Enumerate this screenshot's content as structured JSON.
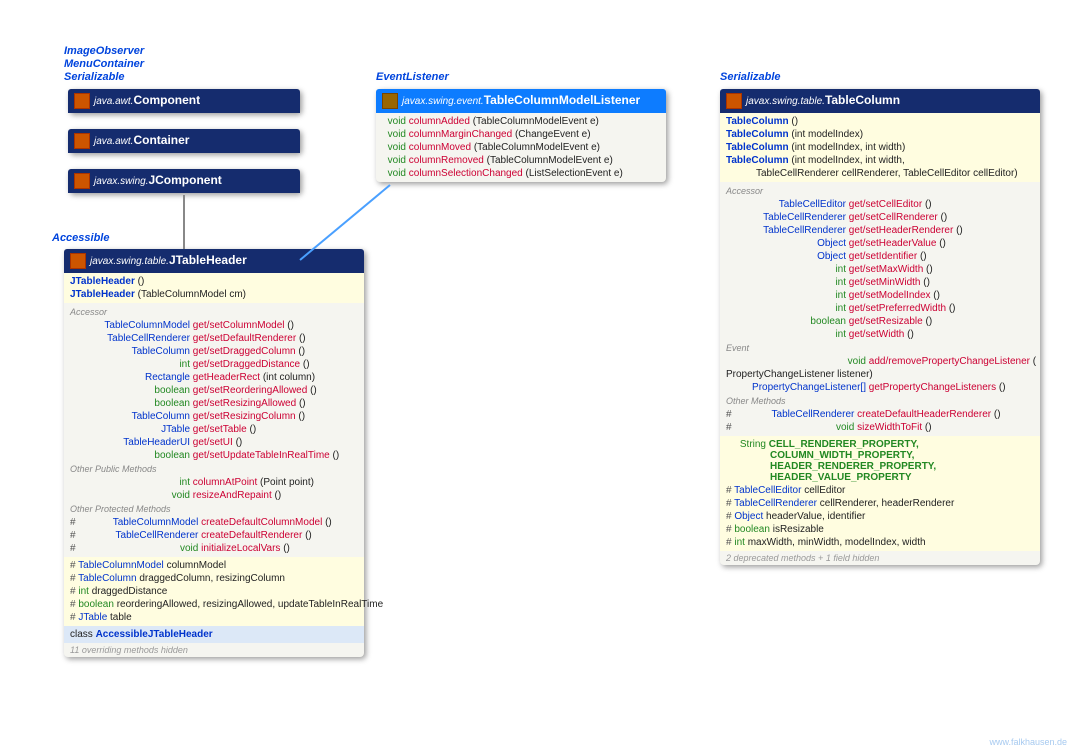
{
  "iface": {
    "imgobs": "ImageObserver",
    "menuc": "MenuContainer",
    "ser": "Serializable",
    "evl": "EventListener",
    "acc": "Accessible"
  },
  "comp": {
    "pkg": "java.awt.",
    "name": "Component"
  },
  "cont": {
    "pkg": "java.awt.",
    "name": "Container"
  },
  "jcomp": {
    "pkg": "javax.swing.",
    "name": "JComponent"
  },
  "listener": {
    "pkg": "javax.swing.event.",
    "name": "TableColumnModelListener",
    "rows": [
      {
        "ret": "void",
        "m": "columnAdded",
        "args": "(TableColumnModelEvent e)"
      },
      {
        "ret": "void",
        "m": "columnMarginChanged",
        "args": "(ChangeEvent e)"
      },
      {
        "ret": "void",
        "m": "columnMoved",
        "args": "(TableColumnModelEvent e)"
      },
      {
        "ret": "void",
        "m": "columnRemoved",
        "args": "(TableColumnModelEvent e)"
      },
      {
        "ret": "void",
        "m": "columnSelectionChanged",
        "args": "(ListSelectionEvent e)"
      }
    ]
  },
  "jth": {
    "pkg": "javax.swing.table.",
    "name": "JTableHeader",
    "ctors": [
      {
        "m": "JTableHeader",
        "args": "()"
      },
      {
        "m": "JTableHeader",
        "args": "(TableColumnModel cm)"
      }
    ],
    "accessor": [
      {
        "ret": "TableColumnModel",
        "m": "get/setColumnModel",
        "args": "()"
      },
      {
        "ret": "TableCellRenderer",
        "m": "get/setDefaultRenderer",
        "args": "()"
      },
      {
        "ret": "TableColumn",
        "m": "get/setDraggedColumn",
        "args": "()"
      },
      {
        "ret": "int",
        "m": "get/setDraggedDistance",
        "args": "()"
      },
      {
        "ret": "Rectangle",
        "m": "getHeaderRect",
        "args": "(int column)"
      },
      {
        "ret": "boolean",
        "m": "get/setReorderingAllowed",
        "args": "()"
      },
      {
        "ret": "boolean",
        "m": "get/setResizingAllowed",
        "args": "()"
      },
      {
        "ret": "TableColumn",
        "m": "get/setResizingColumn",
        "args": "()"
      },
      {
        "ret": "JTable",
        "m": "get/setTable",
        "args": "()"
      },
      {
        "ret": "TableHeaderUI",
        "m": "get/setUI",
        "args": "()"
      },
      {
        "ret": "boolean",
        "m": "get/setUpdateTableInRealTime",
        "args": "()"
      }
    ],
    "otherpub": [
      {
        "ret": "int",
        "m": "columnAtPoint",
        "args": "(Point point)"
      },
      {
        "ret": "void",
        "m": "resizeAndRepaint",
        "args": "()"
      }
    ],
    "otherprot": [
      {
        "ret": "TableColumnModel",
        "m": "createDefaultColumnModel",
        "args": "()"
      },
      {
        "ret": "TableCellRenderer",
        "m": "createDefaultRenderer",
        "args": "()"
      },
      {
        "ret": "void",
        "m": "initializeLocalVars",
        "args": "()"
      }
    ],
    "fields": [
      {
        "ret": "TableColumnModel",
        "f": "columnModel"
      },
      {
        "ret": "TableColumn",
        "f": "draggedColumn, resizingColumn"
      },
      {
        "ret": "int",
        "f": "draggedDistance"
      },
      {
        "ret": "boolean",
        "f": "reorderingAllowed, resizingAllowed, updateTableInRealTime"
      },
      {
        "ret": "JTable",
        "f": "table"
      }
    ],
    "inner": "AccessibleJTableHeader",
    "footer": "11 overriding methods hidden"
  },
  "tc": {
    "pkg": "javax.swing.table.",
    "name": "TableColumn",
    "ctors": [
      {
        "m": "TableColumn",
        "args": "()"
      },
      {
        "m": "TableColumn",
        "args": "(int modelIndex)"
      },
      {
        "m": "TableColumn",
        "args": "(int modelIndex, int width)"
      },
      {
        "m": "TableColumn",
        "args": "(int modelIndex, int width,"
      },
      {
        "m": "",
        "args": "TableCellRenderer cellRenderer, TableCellEditor cellEditor)"
      }
    ],
    "accessor": [
      {
        "ret": "TableCellEditor",
        "m": "get/setCellEditor",
        "args": "()"
      },
      {
        "ret": "TableCellRenderer",
        "m": "get/setCellRenderer",
        "args": "()"
      },
      {
        "ret": "TableCellRenderer",
        "m": "get/setHeaderRenderer",
        "args": "()"
      },
      {
        "ret": "Object",
        "m": "get/setHeaderValue",
        "args": "()"
      },
      {
        "ret": "Object",
        "m": "get/setIdentifier",
        "args": "()"
      },
      {
        "ret": "int",
        "m": "get/setMaxWidth",
        "args": "()"
      },
      {
        "ret": "int",
        "m": "get/setMinWidth",
        "args": "()"
      },
      {
        "ret": "int",
        "m": "get/setModelIndex",
        "args": "()"
      },
      {
        "ret": "int",
        "m": "get/setPreferredWidth",
        "args": "()"
      },
      {
        "ret": "boolean",
        "m": "get/setResizable",
        "args": "()"
      },
      {
        "ret": "int",
        "m": "get/setWidth",
        "args": "()"
      }
    ],
    "event": [
      {
        "ret": "void",
        "m": "add/removePropertyChangeListener",
        "args": "("
      },
      {
        "ret": "",
        "m": "",
        "args": "PropertyChangeListener listener)"
      },
      {
        "ret": "PropertyChangeListener[]",
        "m": "getPropertyChangeListeners",
        "args": "()"
      }
    ],
    "other": [
      {
        "ret": "TableCellRenderer",
        "m": "createDefaultHeaderRenderer",
        "args": "()"
      },
      {
        "ret": "void",
        "m": "sizeWidthToFit",
        "args": "()"
      }
    ],
    "consts": [
      "CELL_RENDERER_PROPERTY,",
      "COLUMN_WIDTH_PROPERTY,",
      "HEADER_RENDERER_PROPERTY,",
      "HEADER_VALUE_PROPERTY"
    ],
    "fields": [
      {
        "ret": "TableCellEditor",
        "f": "cellEditor"
      },
      {
        "ret": "TableCellRenderer",
        "f": "cellRenderer, headerRenderer"
      },
      {
        "ret": "Object",
        "f": "headerValue, identifier"
      },
      {
        "ret": "boolean",
        "f": "isResizable"
      },
      {
        "ret": "int",
        "f": "maxWidth, minWidth, modelIndex, width"
      }
    ],
    "footer": "2 deprecated methods + 1 field hidden"
  },
  "sec": {
    "acc": "Accessor",
    "opm": "Other Public Methods",
    "oprm": "Other Protected Methods",
    "ev": "Event",
    "om": "Other Methods"
  },
  "kw": {
    "cls": "class",
    "str": "String"
  },
  "wm": "www.falkhausen.de"
}
